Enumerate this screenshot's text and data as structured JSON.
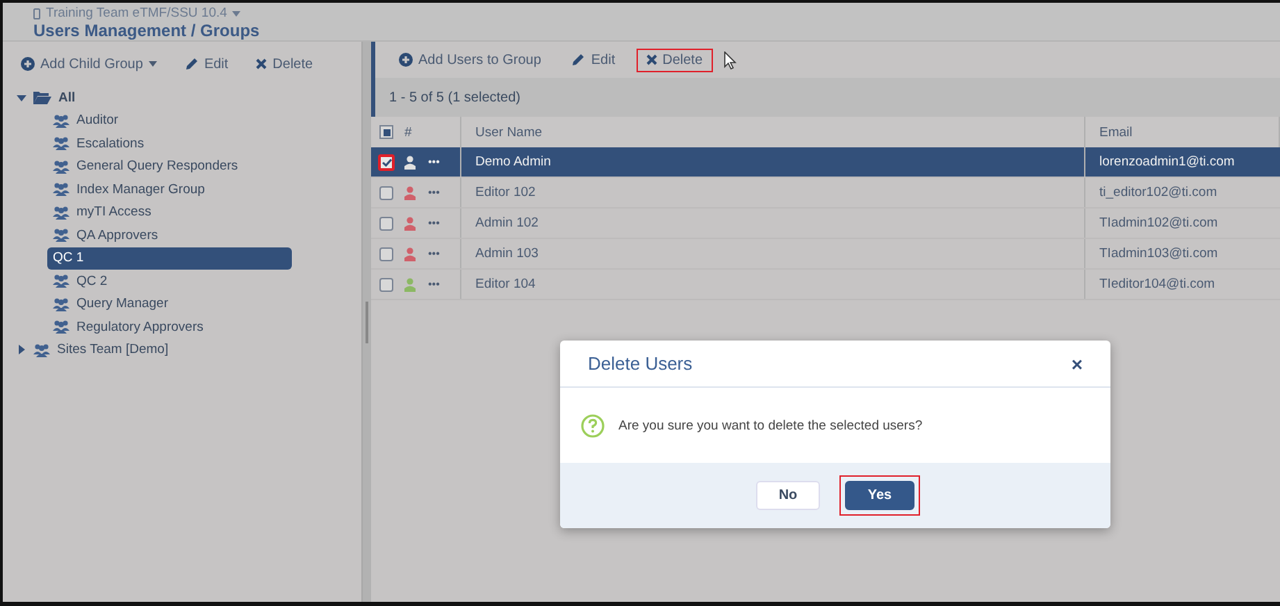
{
  "header": {
    "breadcrumb": "Training Team eTMF/SSU 10.4",
    "title": "Users Management / Groups"
  },
  "left_toolbar": [
    {
      "kind": "add",
      "label": "Add Child Group",
      "dropdown": true
    },
    {
      "kind": "edit",
      "label": "Edit",
      "dropdown": false
    },
    {
      "kind": "delete",
      "label": "Delete",
      "dropdown": false
    }
  ],
  "tree": [
    {
      "label": "All",
      "expanded": true,
      "selected": false,
      "children": [
        {
          "label": "Auditor",
          "selected": false
        },
        {
          "label": "Escalations",
          "selected": false
        },
        {
          "label": "General Query Responders",
          "selected": false
        },
        {
          "label": "Index Manager Group",
          "selected": false
        },
        {
          "label": "myTI Access",
          "selected": false
        },
        {
          "label": "QA Approvers",
          "selected": false
        },
        {
          "label": "QC 1",
          "selected": true
        },
        {
          "label": "QC 2",
          "selected": false
        },
        {
          "label": "Query Manager",
          "selected": false
        },
        {
          "label": "Regulatory Approvers",
          "selected": false
        }
      ]
    },
    {
      "label": "Sites Team [Demo]",
      "expanded": false,
      "selected": false
    }
  ],
  "right_toolbar": [
    {
      "kind": "add",
      "label": "Add Users to Group",
      "highlighted": false
    },
    {
      "kind": "edit",
      "label": "Edit",
      "highlighted": false
    },
    {
      "kind": "delete",
      "label": "Delete",
      "highlighted": true
    }
  ],
  "count": "1 - 5 of 5 (1 selected)",
  "table": {
    "select_all": {
      "indeterminate": true
    },
    "columns": [
      "#",
      "User Name",
      "Email"
    ],
    "rows": [
      {
        "name": "Demo Admin",
        "email": "lorenzoadmin1@ti.com",
        "selected": true,
        "checked": true,
        "highlighted": true,
        "color": "#e0e0e0",
        "menu": "•••"
      },
      {
        "name": "Editor 102",
        "email": "ti_editor102@ti.com",
        "selected": false,
        "checked": false,
        "highlighted": false,
        "color": "#d0606a",
        "menu": "•••"
      },
      {
        "name": "Admin 102",
        "email": "TIadmin102@ti.com",
        "selected": false,
        "checked": false,
        "highlighted": false,
        "color": "#d0606a",
        "menu": "•••"
      },
      {
        "name": "Admin 103",
        "email": "TIadmin103@ti.com",
        "selected": false,
        "checked": false,
        "highlighted": false,
        "color": "#d0606a",
        "menu": "•••"
      },
      {
        "name": "Editor 104",
        "email": "TIeditor104@ti.com",
        "selected": false,
        "checked": false,
        "highlighted": false,
        "color": "#8cb864",
        "menu": "•••"
      }
    ]
  },
  "dialog": {
    "title": "Delete Users",
    "close": "×",
    "message": "Are you sure you want to delete the selected users?",
    "buttons": [
      {
        "label": "No",
        "kind": "secondary",
        "highlighted": false
      },
      {
        "label": "Yes",
        "kind": "primary",
        "highlighted": true
      }
    ]
  }
}
